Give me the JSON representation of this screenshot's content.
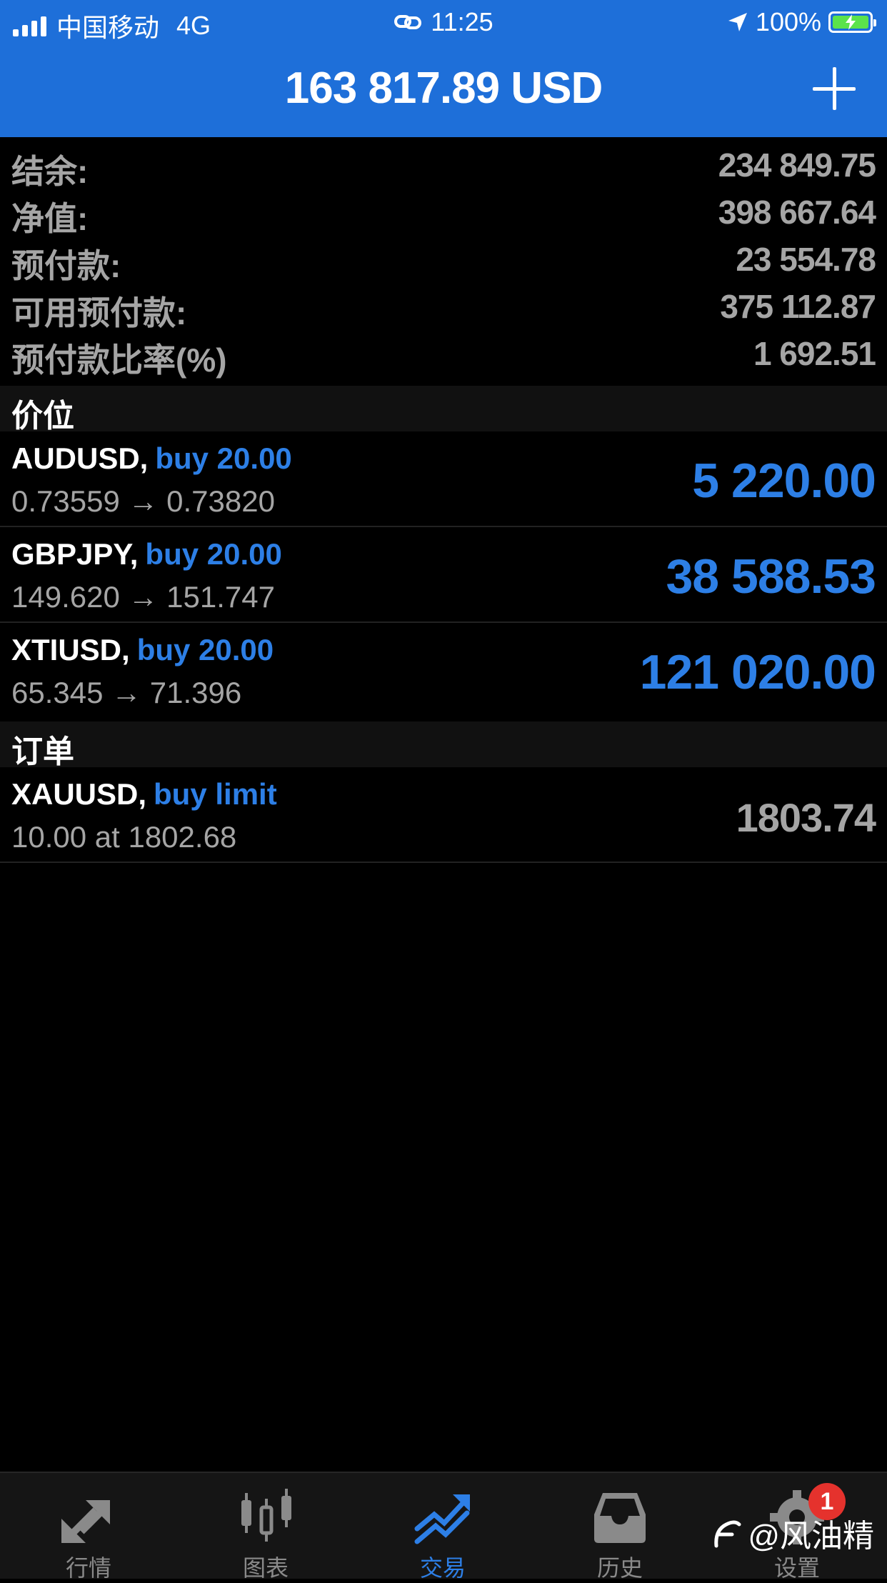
{
  "status_bar": {
    "carrier": "中国移动",
    "network": "4G",
    "time": "11:25",
    "battery": "100%"
  },
  "header": {
    "title": "163 817.89 USD",
    "add_icon": "plus-icon"
  },
  "summary": [
    {
      "label": "结余:",
      "value": "234 849.75"
    },
    {
      "label": "净值:",
      "value": "398 667.64"
    },
    {
      "label": "预付款:",
      "value": "23 554.78"
    },
    {
      "label": "可用预付款:",
      "value": "375 112.87"
    },
    {
      "label": "预付款比率(%)",
      "value": "1 692.51"
    }
  ],
  "positions_section": "价位",
  "positions": [
    {
      "symbol": "AUDUSD,",
      "type": "buy 20.00",
      "prices": "0.73559 → 0.73820",
      "profit": "5 220.00"
    },
    {
      "symbol": "GBPJPY,",
      "type": "buy 20.00",
      "prices": "149.620 → 151.747",
      "profit": "38 588.53"
    },
    {
      "symbol": "XTIUSD,",
      "type": "buy 20.00",
      "prices": "65.345 → 71.396",
      "profit": "121 020.00"
    }
  ],
  "orders_section": "订单",
  "orders": [
    {
      "symbol": "XAUUSD,",
      "type": "buy limit",
      "prices": "10.00 at 1802.68",
      "price": "1803.74"
    }
  ],
  "tabs": [
    {
      "label": "行情",
      "icon": "quotes-arrows-icon"
    },
    {
      "label": "图表",
      "icon": "candlestick-chart-icon"
    },
    {
      "label": "交易",
      "icon": "trade-trend-icon",
      "active": true
    },
    {
      "label": "历史",
      "icon": "history-inbox-icon"
    },
    {
      "label": "设置",
      "icon": "gear-icon",
      "badge": "1"
    }
  ],
  "watermark": "@风油精",
  "colors": {
    "header_blue": "#1E6FD9",
    "accent_blue": "#2D7FE6",
    "muted_gray": "#A5A5A5",
    "badge_red": "#E5322D"
  }
}
